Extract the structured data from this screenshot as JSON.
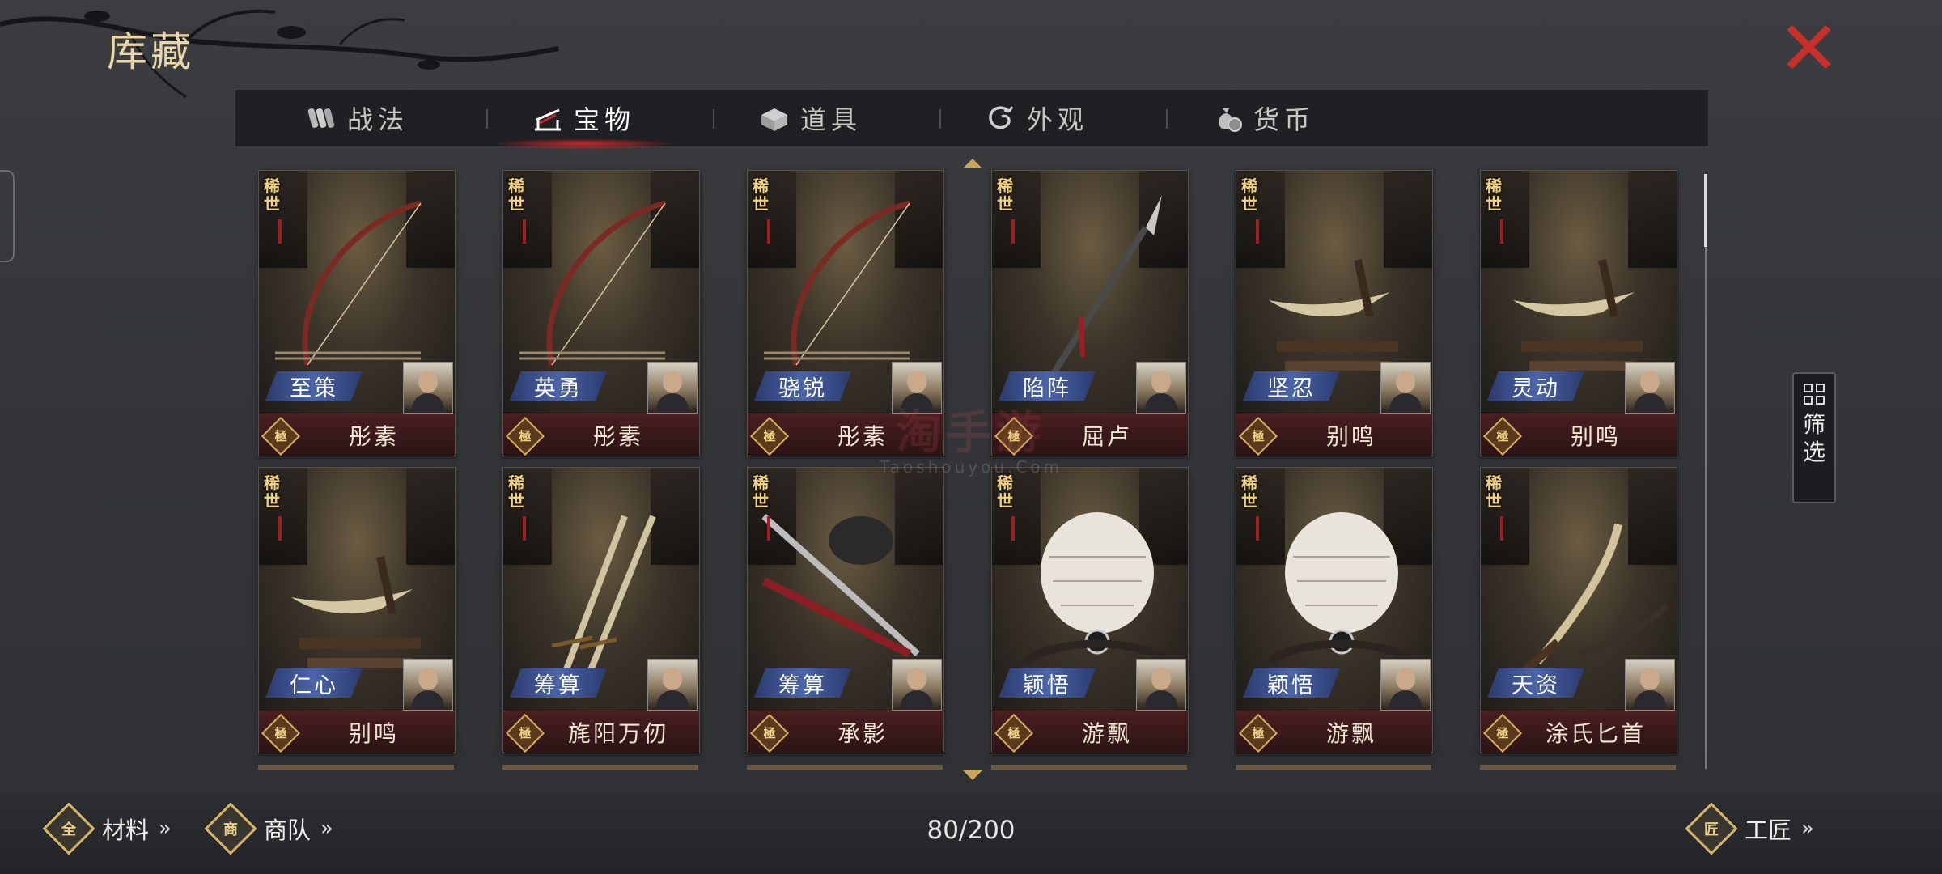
{
  "title": "库藏",
  "tabs": [
    {
      "label": "战法",
      "icon": "scroll-bundle-icon",
      "active": false
    },
    {
      "label": "宝物",
      "icon": "weapon-rack-icon",
      "active": true
    },
    {
      "label": "道具",
      "icon": "box-icon",
      "active": false
    },
    {
      "label": "外观",
      "icon": "swirl-icon",
      "active": false
    },
    {
      "label": "货币",
      "icon": "money-bag-icon",
      "active": false
    }
  ],
  "cards": [
    {
      "rarity": "稀世",
      "skill": "至策",
      "grade": "極",
      "name": "彤素",
      "art": "bow"
    },
    {
      "rarity": "稀世",
      "skill": "英勇",
      "grade": "極",
      "name": "彤素",
      "art": "bow"
    },
    {
      "rarity": "稀世",
      "skill": "骁锐",
      "grade": "極",
      "name": "彤素",
      "art": "bow"
    },
    {
      "rarity": "稀世",
      "skill": "陷阵",
      "grade": "極",
      "name": "屈卢",
      "art": "spear"
    },
    {
      "rarity": "稀世",
      "skill": "坚忍",
      "grade": "極",
      "name": "别鸣",
      "art": "dagger"
    },
    {
      "rarity": "稀世",
      "skill": "灵动",
      "grade": "極",
      "name": "别鸣",
      "art": "dagger"
    },
    {
      "rarity": "稀世",
      "skill": "仁心",
      "grade": "極",
      "name": "别鸣",
      "art": "dagger"
    },
    {
      "rarity": "稀世",
      "skill": "筹算",
      "grade": "極",
      "name": "旄阳万仞",
      "art": "twin-swords"
    },
    {
      "rarity": "稀世",
      "skill": "筹算",
      "grade": "極",
      "name": "承影",
      "art": "sword"
    },
    {
      "rarity": "稀世",
      "skill": "颖悟",
      "grade": "極",
      "name": "游飘",
      "art": "feather-fan"
    },
    {
      "rarity": "稀世",
      "skill": "颖悟",
      "grade": "極",
      "name": "游飘",
      "art": "feather-fan"
    },
    {
      "rarity": "稀世",
      "skill": "天资",
      "grade": "極",
      "name": "涂氏匕首",
      "art": "curved-blade"
    }
  ],
  "filter": {
    "label": "筛选"
  },
  "footer": {
    "materials": {
      "label": "材料",
      "icon_char": "全",
      "arrows": "»"
    },
    "caravan": {
      "label": "商队",
      "icon_char": "商",
      "arrows": "»"
    },
    "count": "80/200",
    "craftsman": {
      "label": "工匠",
      "icon_char": "匠",
      "arrows": "»"
    }
  },
  "watermark": {
    "main": "淘手游",
    "sub": "Taoshouyou.Com"
  },
  "colors": {
    "accent_red": "#c9302c",
    "gold": "#d6b56a",
    "skill_blue": "#4a64a8",
    "card_bottom": "#4a1e20"
  }
}
